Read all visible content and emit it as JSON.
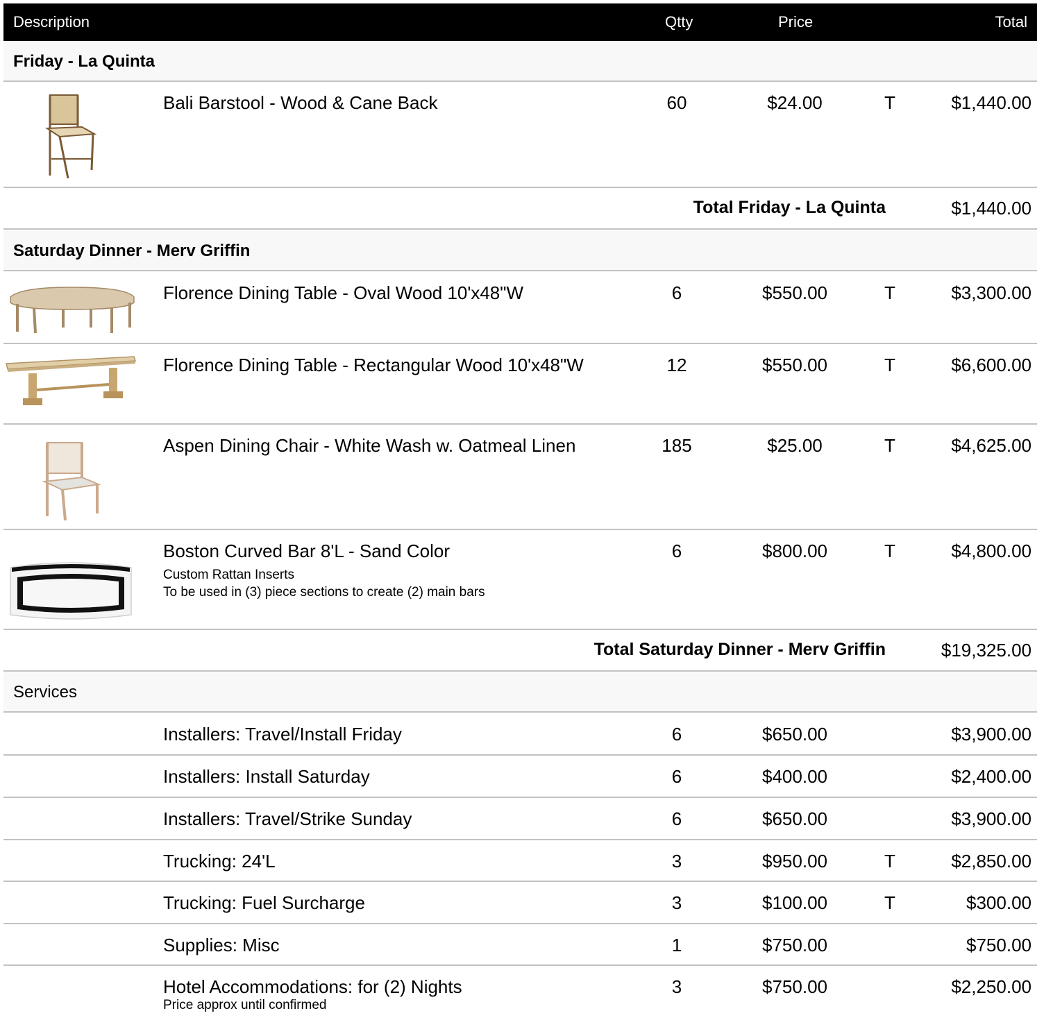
{
  "header": {
    "description": "Description",
    "qty": "Qtty",
    "price": "Price",
    "total": "Total"
  },
  "sections": [
    {
      "title": "Friday - La Quinta",
      "items": [
        {
          "description": "Bali Barstool - Wood & Cane Back",
          "qty": "60",
          "price": "$24.00",
          "tax": "T",
          "total": "$1,440.00",
          "image": "barstool-image"
        }
      ],
      "subtotal_label": "Total Friday - La Quinta",
      "subtotal_value": "$1,440.00"
    },
    {
      "title": "Saturday Dinner - Merv Griffin",
      "items": [
        {
          "description": "Florence Dining Table - Oval Wood 10'x48\"W",
          "qty": "6",
          "price": "$550.00",
          "tax": "T",
          "total": "$3,300.00",
          "image": "oval-table-image"
        },
        {
          "description": "Florence Dining Table - Rectangular Wood 10'x48\"W",
          "qty": "12",
          "price": "$550.00",
          "tax": "T",
          "total": "$6,600.00",
          "image": "rect-table-image"
        },
        {
          "description": "Aspen Dining Chair - White Wash w. Oatmeal Linen",
          "qty": "185",
          "price": "$25.00",
          "tax": "T",
          "total": "$4,625.00",
          "image": "dining-chair-image"
        },
        {
          "description": "Boston Curved Bar 8'L - Sand Color",
          "notes": [
            "Custom Rattan Inserts",
            "To be used in (3) piece sections to create (2) main bars"
          ],
          "qty": "6",
          "price": "$800.00",
          "tax": "T",
          "total": "$4,800.00",
          "image": "curved-bar-image"
        }
      ],
      "subtotal_label": "Total Saturday Dinner - Merv Griffin",
      "subtotal_value": "$19,325.00"
    },
    {
      "title": "Services",
      "items": [
        {
          "description": "Installers: Travel/Install Friday",
          "qty": "6",
          "price": "$650.00",
          "tax": "",
          "total": "$3,900.00"
        },
        {
          "description": "Installers: Install Saturday",
          "qty": "6",
          "price": "$400.00",
          "tax": "",
          "total": "$2,400.00"
        },
        {
          "description": "Installers: Travel/Strike Sunday",
          "qty": "6",
          "price": "$650.00",
          "tax": "",
          "total": "$3,900.00"
        },
        {
          "description": "Trucking: 24'L",
          "qty": "3",
          "price": "$950.00",
          "tax": "T",
          "total": "$2,850.00"
        },
        {
          "description": "Trucking: Fuel Surcharge",
          "qty": "3",
          "price": "$100.00",
          "tax": "T",
          "total": "$300.00"
        },
        {
          "description": "Supplies: Misc",
          "qty": "1",
          "price": "$750.00",
          "tax": "",
          "total": "$750.00"
        },
        {
          "description": "Hotel Accommodations: for (2) Nights",
          "notes": [
            "Price approx until confirmed"
          ],
          "qty": "3",
          "price": "$750.00",
          "tax": "",
          "total": "$2,250.00"
        }
      ]
    }
  ]
}
